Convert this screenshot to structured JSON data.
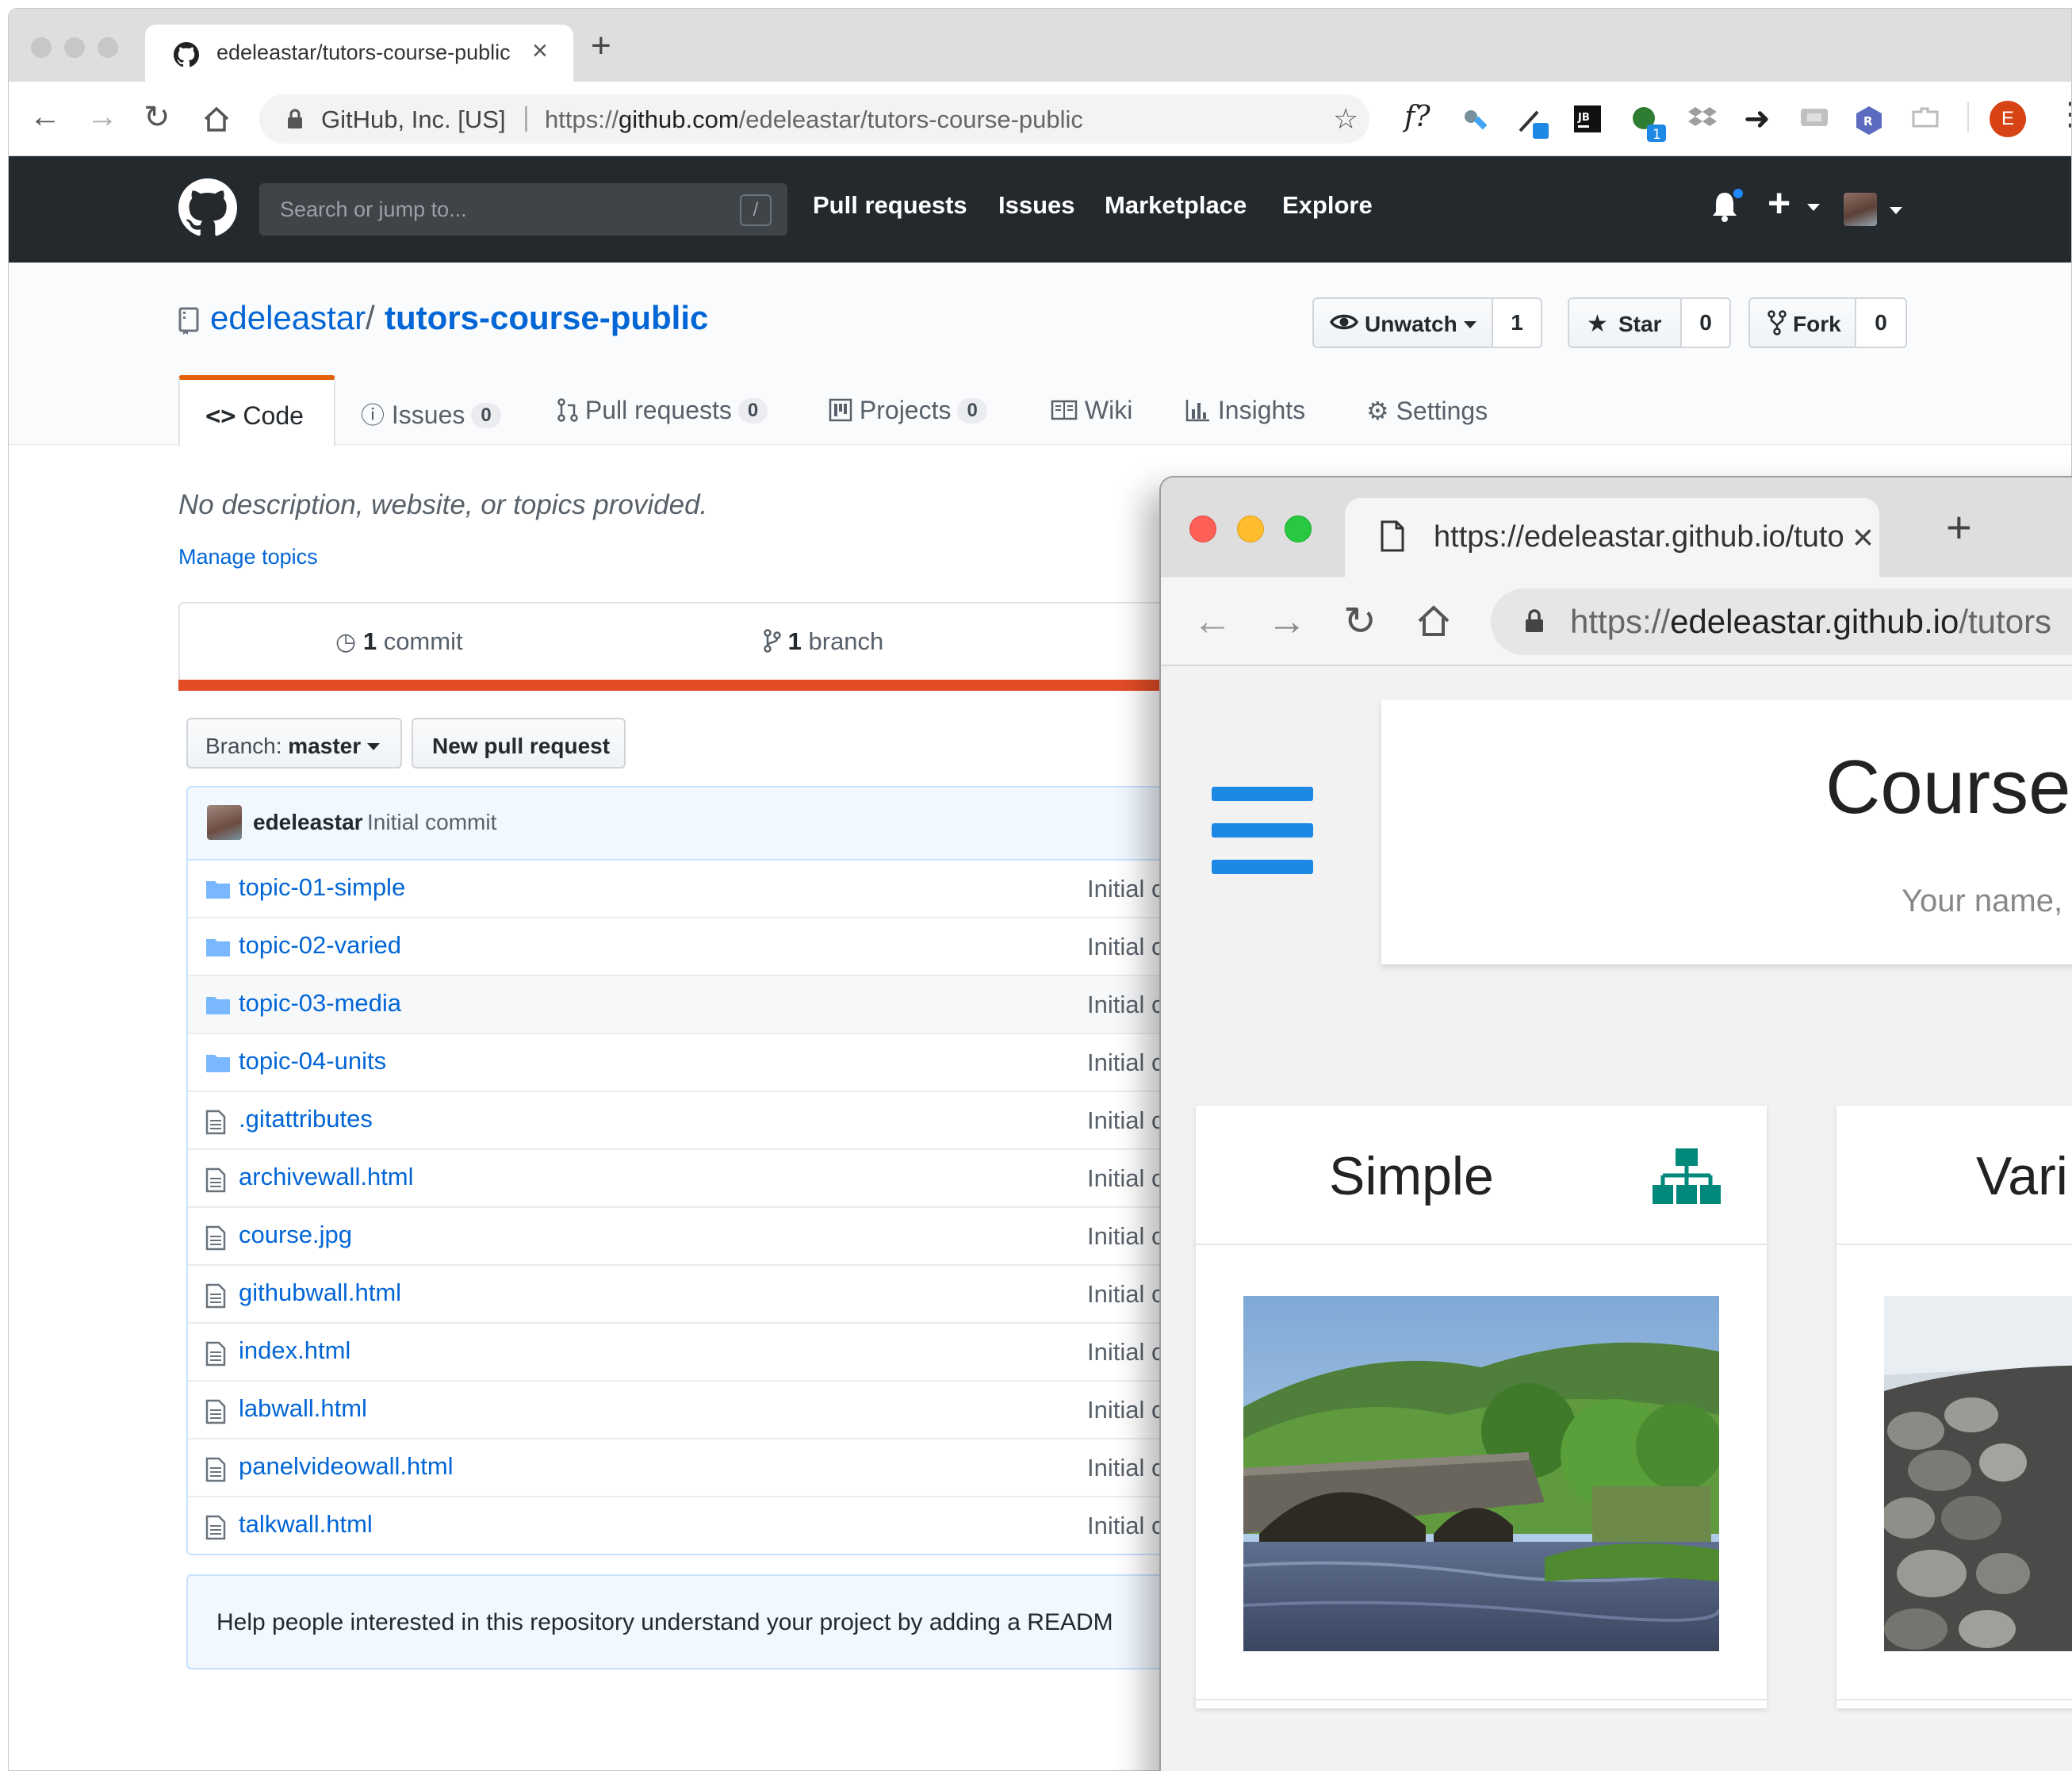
{
  "back_browser": {
    "tab_title": "edeleastar/tutors-course-public",
    "address_org": "GitHub, Inc. [US]",
    "address_scheme": "https://",
    "address_host": "github.com",
    "address_path": "/edeleastar/tutors-course-public",
    "extension_fx": "f?",
    "extension_jb": "JB",
    "extension_badge": "1",
    "extension_r": "R",
    "profile_initial": "E"
  },
  "github_header": {
    "search_placeholder": "Search or jump to...",
    "search_key": "/",
    "links": [
      "Pull requests",
      "Issues",
      "Marketplace",
      "Explore"
    ]
  },
  "repo": {
    "owner": "edeleastar",
    "separator": "/",
    "name": "tutors-course-public",
    "unwatch_label": "Unwatch",
    "watch_count": "1",
    "star_label": "Star",
    "star_count": "0",
    "fork_label": "Fork",
    "fork_count": "0",
    "tabs": {
      "code": "Code",
      "issues": "Issues",
      "issues_count": "0",
      "pulls": "Pull requests",
      "pulls_count": "0",
      "projects": "Projects",
      "projects_count": "0",
      "wiki": "Wiki",
      "insights": "Insights",
      "settings": "Settings"
    },
    "description": "No description, website, or topics provided.",
    "manage_topics": "Manage topics",
    "commits_num": "1",
    "commits_label": "commit",
    "branches_num": "1",
    "branches_label": "branch",
    "branch_prefix": "Branch:",
    "branch_name": "master",
    "new_pr": "New pull request",
    "latest_commit_author": "edeleastar",
    "latest_commit_message": "Initial commit",
    "files": [
      {
        "name": "topic-01-simple",
        "type": "dir",
        "commit": "Initial c"
      },
      {
        "name": "topic-02-varied",
        "type": "dir",
        "commit": "Initial c"
      },
      {
        "name": "topic-03-media",
        "type": "dir",
        "commit": "Initial c"
      },
      {
        "name": "topic-04-units",
        "type": "dir",
        "commit": "Initial c"
      },
      {
        "name": ".gitattributes",
        "type": "file",
        "commit": "Initial c"
      },
      {
        "name": "archivewall.html",
        "type": "file",
        "commit": "Initial c"
      },
      {
        "name": "course.jpg",
        "type": "file",
        "commit": "Initial c"
      },
      {
        "name": "githubwall.html",
        "type": "file",
        "commit": "Initial c"
      },
      {
        "name": "index.html",
        "type": "file",
        "commit": "Initial c"
      },
      {
        "name": "labwall.html",
        "type": "file",
        "commit": "Initial c"
      },
      {
        "name": "panelvideowall.html",
        "type": "file",
        "commit": "Initial c"
      },
      {
        "name": "talkwall.html",
        "type": "file",
        "commit": "Initial c"
      }
    ],
    "readme_prompt": "Help people interested in this repository understand your project by adding a READM"
  },
  "front_browser": {
    "tab_title": "https://edeleastar.github.io/tutors-course-public/",
    "address_scheme": "https://",
    "address_host": "edeleastar.github.io",
    "address_path": "/tutors",
    "course_title": "Course",
    "course_subtitle": "Your name,",
    "cards": [
      {
        "title": "Simple",
        "icon": "sitemap-icon"
      },
      {
        "title": "Vari"
      }
    ]
  },
  "colors": {
    "github_dark": "#24292e",
    "link_blue": "#0366d6",
    "language_bar": "#e34c26",
    "tab_accent": "#e36209",
    "course_blue": "#1e88e5",
    "card_icon_teal": "#00897b"
  }
}
